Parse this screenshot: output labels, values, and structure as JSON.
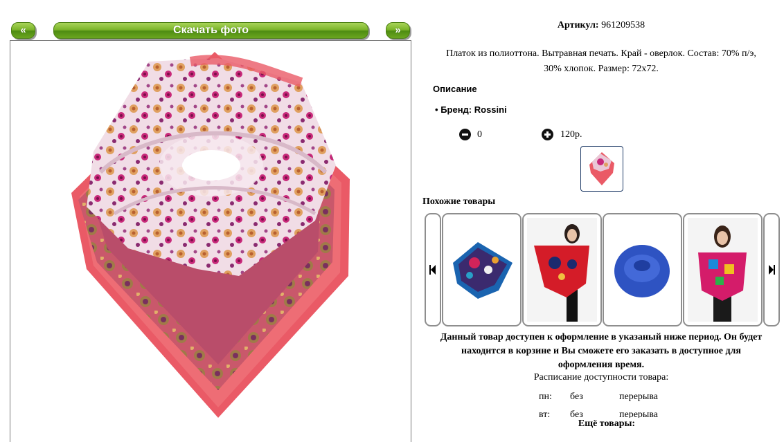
{
  "nav": {
    "prev_label": "«",
    "download_label": "Скачать фото",
    "next_label": "»"
  },
  "product": {
    "article_label": "Артикул:",
    "article_value": "961209538",
    "description_line1": "Платок из полиоттона. Вытравная печать. Край - оверлок. Состав: 70% п/э,",
    "description_line2": "30% хлопок. Размер: 72x72.",
    "section_title": "Описание",
    "brand": "Бренд: Rossini",
    "quantity": "0",
    "price": "120р."
  },
  "similar": {
    "title": "Похожие товары",
    "items": [
      "scarf-blue-paisley",
      "woman-red-shawl",
      "blue-snood",
      "woman-multicolor-scarf"
    ]
  },
  "availability": {
    "notice_line1": "Данный товар доступен к оформление в указаный ниже период. Он будет",
    "notice_line2": "находится в корзине и Вы сможете его заказать в доступное для",
    "notice_line3": "оформления время.",
    "schedule_title": "Расписание доступности товара:",
    "rows": [
      {
        "day": "пн:",
        "from": "без",
        "to": "перерыва"
      },
      {
        "day": "вт:",
        "from": "без",
        "to": "перерыва"
      }
    ]
  },
  "more_title": "Ещё товары:",
  "colors": {
    "green": "#7cb52a",
    "border": "#8e8e8e"
  }
}
